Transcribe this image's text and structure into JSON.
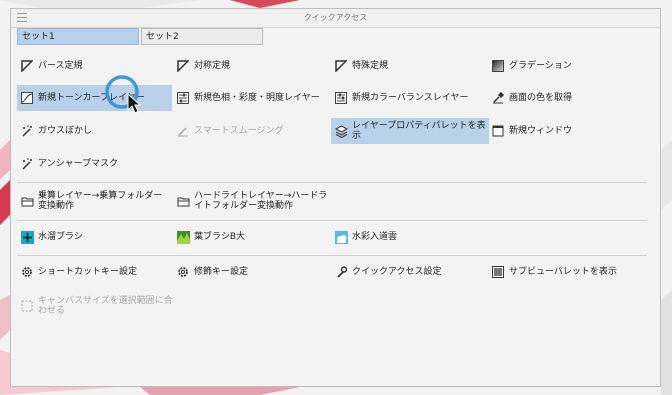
{
  "window": {
    "title": "クイックアクセス"
  },
  "tabs": [
    {
      "label": "セット1",
      "active": true
    },
    {
      "label": "セット2",
      "active": false
    }
  ],
  "items": {
    "perspective_ruler": "パース定規",
    "symmetry_ruler": "対称定規",
    "special_ruler": "特殊定規",
    "gradation": "グラデーション",
    "new_tone_curve_layer": "新規トーンカーブレイヤー",
    "new_hue_layer": "新規色相・彩度・明度レイヤー",
    "new_color_balance_layer": "新規カラーバランスレイヤー",
    "get_screen_color": "画面の色を取得",
    "gaussian_blur": "ガウスぼかし",
    "smart_smoothing": "スマートスムージング",
    "layer_property_palette": "レイヤープロパティパレットを表示",
    "new_window": "新規ウィンドウ",
    "unsharp_mask": "アンシャープマスク",
    "multiply_layer_folder": "乗算レイヤー→乗算フォルダー変換動作",
    "hardlight_layer_folder": "ハードライトレイヤー→ハードライトフォルダー変換動作",
    "water_brush": "水溜ブラシ",
    "leaf_brush": "葉ブラシB大",
    "watercolor_cloud": "水彩入道雲",
    "shortcut_settings": "ショートカットキー設定",
    "modifier_key_settings": "修飾キー設定",
    "quick_access_settings": "クイックアクセス設定",
    "sub_view_palette": "サブビューパレットを表示",
    "canvas_size_to_selection": "キャンバスサイズを選択範囲に合わせる"
  },
  "colors": {
    "selected_bg": "#b8d0ea",
    "cursor_ring": "#2d8fd8",
    "disabled_text": "#a8a8a8"
  }
}
